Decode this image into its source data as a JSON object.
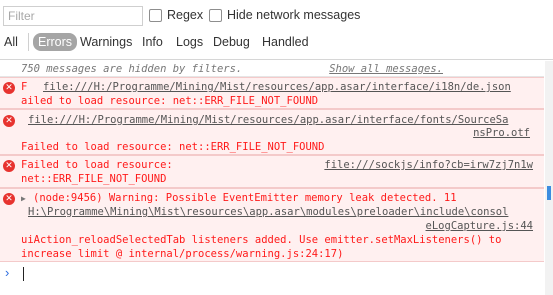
{
  "toolbar": {
    "filter_placeholder": "Filter",
    "regex_label": "Regex",
    "hide_network_label": "Hide network messages",
    "levels": [
      "All",
      "Errors",
      "Warnings",
      "Info",
      "Logs",
      "Debug",
      "Handled"
    ],
    "active_level": "Errors"
  },
  "hidden_notice": {
    "text": "750 messages are hidden by filters.",
    "link": "Show all messages."
  },
  "messages": [
    {
      "line1_prefix": "F  ",
      "line1_link": "file:///H:/Programme/Mining/Mist/resources/app.asar/interface/i18n/de.json",
      "line2": "ailed to load resource: net::ERR_FILE_NOT_FOUND"
    },
    {
      "line1_link": "file:///H:/Programme/Mining/Mist/resources/app.asar/interface/fonts/SourceSa",
      "line2_link": "nsPro.otf",
      "line3": "Failed to load resource: net::ERR_FILE_NOT_FOUND"
    },
    {
      "line1": "Failed to load resource:",
      "line1_link": "file:///sockjs/info?cb=irw7zj7n1w",
      "line2": "net::ERR_FILE_NOT_FOUND"
    },
    {
      "line1": "(node:9456) Warning: Possible EventEmitter memory leak detected. 11",
      "line2_link": "H:\\Programme\\Mining\\Mist\\resources\\app.asar\\modules\\preloader\\include\\consol",
      "line3_link": "eLogCapture.js:44",
      "line4": "uiAction_reloadSelectedTab listeners added. Use emitter.setMaxListeners() to",
      "line5": "increase limit @ internal/process/warning.js:24:17)"
    }
  ],
  "prompt_symbol": "›",
  "colors": {
    "error_text": "#ff1a1a",
    "error_bg": "#fff0f0",
    "error_icon": "#e7332f",
    "active_pill": "#a5a5a5",
    "prompt": "#2c6ddf",
    "scroll_thumb": "#3b8de0"
  }
}
